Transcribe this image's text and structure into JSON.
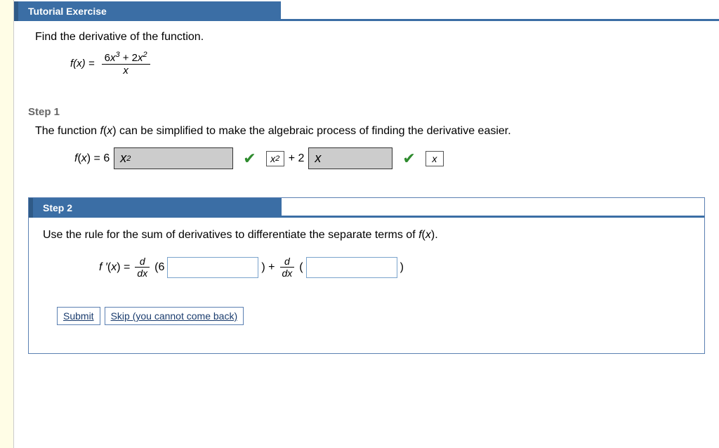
{
  "header": {
    "title": "Tutorial Exercise"
  },
  "question": {
    "prompt": "Find the derivative of the function.",
    "fx_label": "f(x) =",
    "numerator": "6x³ + 2x²",
    "numerator_parts": {
      "a_coef": "6",
      "a_var": "x",
      "a_exp": "3",
      "plus": " + ",
      "b_coef": "2",
      "b_var": "x",
      "b_exp": "2"
    },
    "denominator": "x"
  },
  "step1": {
    "label": "Step 1",
    "text": "The function f(x) can be simplified to make the algebraic process of finding the derivative easier.",
    "eq_prefix": "f(x) = 6",
    "answer1_display": "x²",
    "answer1_var": "x",
    "answer1_exp": "2",
    "mini1": "x²",
    "mini1_var": "x",
    "mini1_exp": "2",
    "mid_text": " + 2",
    "answer2_display": "x",
    "mini2": "x"
  },
  "step2": {
    "label": "Step 2",
    "text": "Use the rule for the sum of derivatives to differentiate the separate terms of f(x).",
    "fprime_label": "f ′(x) =",
    "ddx_num": "d",
    "ddx_den": "dx",
    "open1": "(6",
    "close1": ") +",
    "open2": "(",
    "close2": ")",
    "input1_value": "",
    "input2_value": ""
  },
  "buttons": {
    "submit": "Submit",
    "skip": "Skip (you cannot come back)"
  }
}
